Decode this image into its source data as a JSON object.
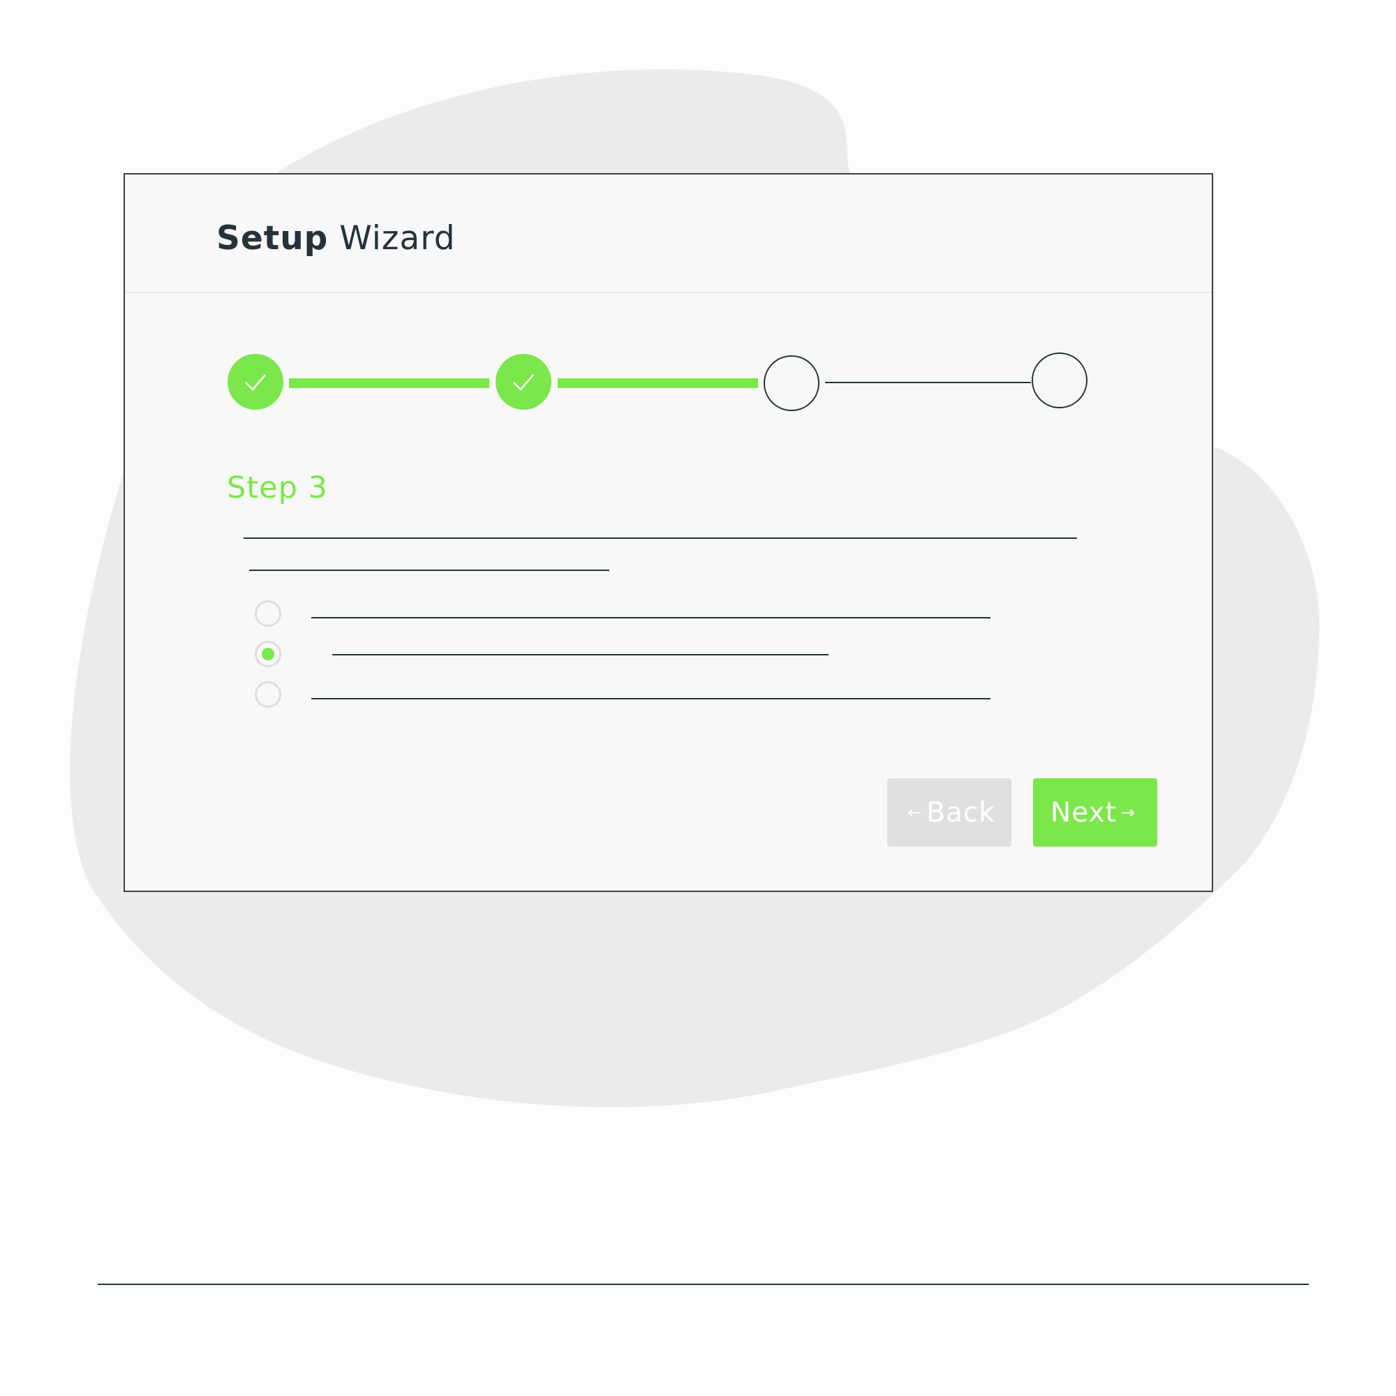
{
  "window": {
    "title_bold": "Setup",
    "title_rest": "Wizard"
  },
  "stepper": {
    "steps": [
      {
        "state": "done",
        "icon": "check-icon"
      },
      {
        "state": "done",
        "icon": "check-icon"
      },
      {
        "state": "current"
      },
      {
        "state": "todo"
      }
    ],
    "current_step_label": "Step 3"
  },
  "options": {
    "count": 3,
    "selected_index": 1
  },
  "buttons": {
    "back_label": "Back",
    "back_arrow": "←",
    "next_label": "Next",
    "next_arrow": "→"
  },
  "colors": {
    "accent": "#7be74a",
    "text_dark": "#263238",
    "disabled": "#e0e0e0",
    "blob": "#ebebeb"
  }
}
